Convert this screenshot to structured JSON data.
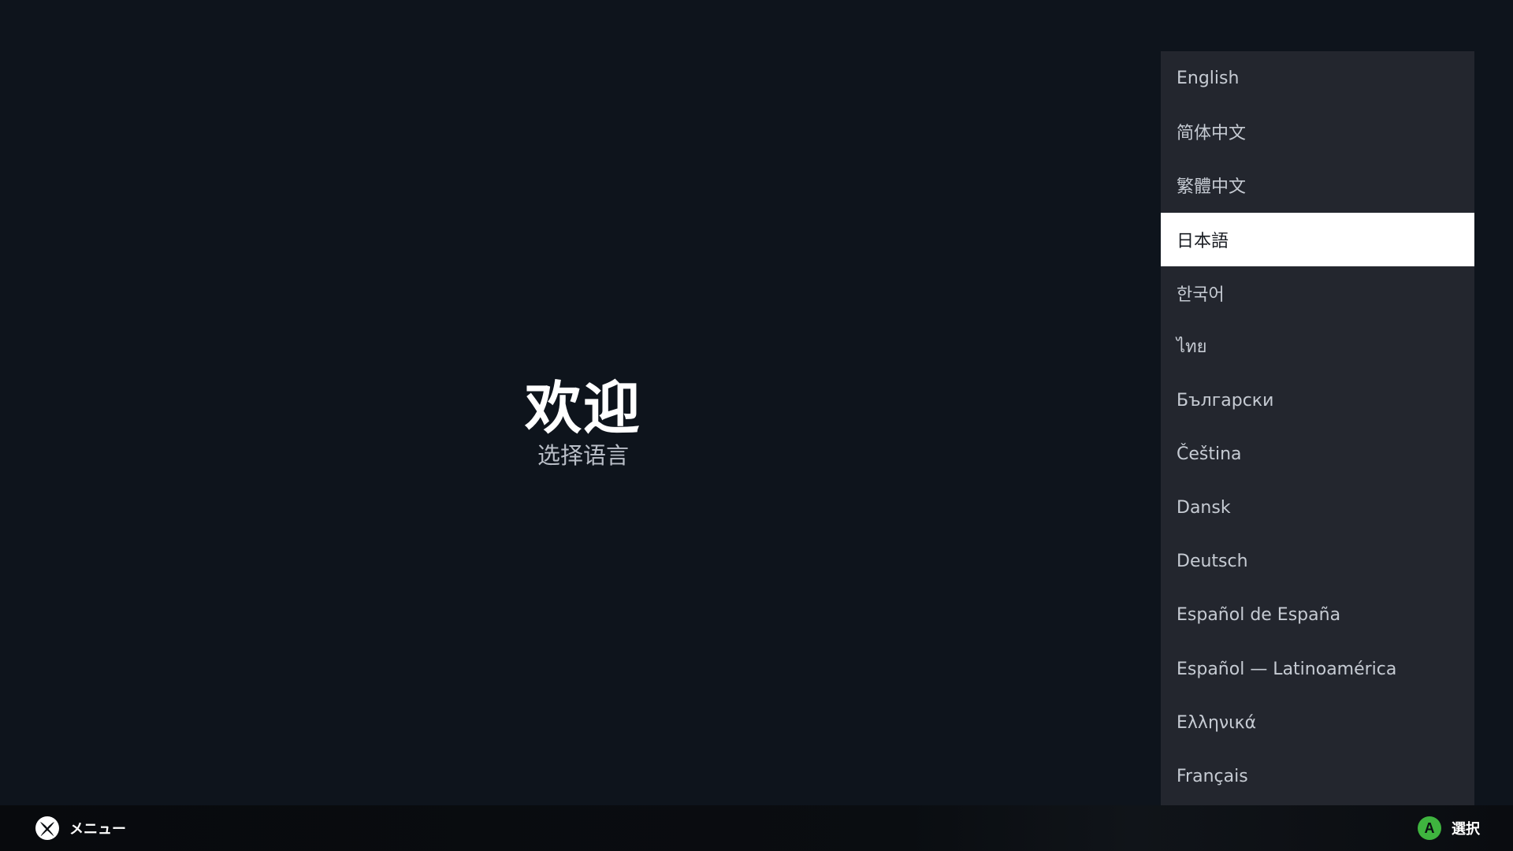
{
  "welcome": {
    "title": "欢迎",
    "subtitle": "选择语言"
  },
  "languages": {
    "selected_index": 3,
    "items": [
      {
        "label": "English"
      },
      {
        "label": "简体中文"
      },
      {
        "label": "繁體中文"
      },
      {
        "label": "日本語"
      },
      {
        "label": "한국어"
      },
      {
        "label": "ไทย"
      },
      {
        "label": "Български"
      },
      {
        "label": "Čeština"
      },
      {
        "label": "Dansk"
      },
      {
        "label": "Deutsch"
      },
      {
        "label": "Español de España"
      },
      {
        "label": "Español — Latinoamérica"
      },
      {
        "label": "Ελληνικά"
      },
      {
        "label": "Français"
      }
    ]
  },
  "footer": {
    "menu_label": "メニュー",
    "menu_icon": "xbox-icon",
    "select_label": "選択",
    "select_icon": "a-button-icon",
    "select_icon_letter": "A",
    "select_icon_color": "#3fb43f"
  },
  "colors": {
    "background": "#0e141c",
    "panel": "#23262e",
    "selected_row": "#ffffff"
  }
}
